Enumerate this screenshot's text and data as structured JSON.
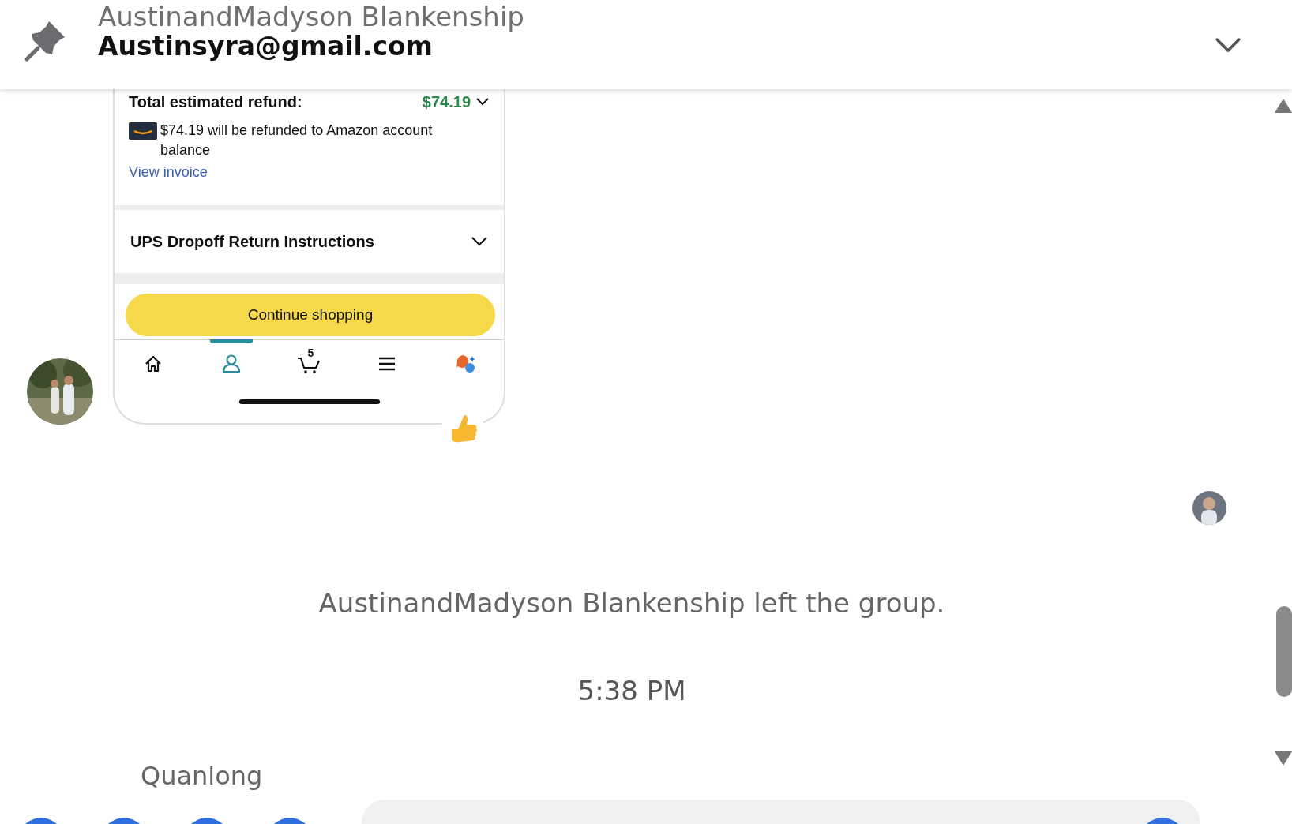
{
  "header": {
    "name": "AustinandMadyson Blankenship",
    "email": "Austinsyra@gmail.com"
  },
  "shared_screenshot": {
    "refund_label": "Total estimated refund:",
    "refund_amount": "$74.19",
    "refund_note": "$74.19 will be refunded to Amazon account balance",
    "invoice_link": "View invoice",
    "section_title": "UPS Dropoff Return Instructions",
    "button": "Continue shopping",
    "nav": [
      {
        "kind": "home",
        "selected": false
      },
      {
        "kind": "account",
        "selected": true
      },
      {
        "kind": "cart",
        "selected": false,
        "badge": "5"
      },
      {
        "kind": "menu",
        "selected": false
      },
      {
        "kind": "assistant",
        "selected": false
      }
    ]
  },
  "system_notice": "AustinandMadyson Blankenship left the group.",
  "time": "5:38 PM",
  "sender": "Quanlong"
}
